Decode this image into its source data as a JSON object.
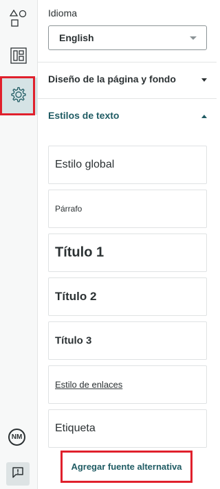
{
  "sidebar": {
    "items": [
      {
        "icon": "shapes-icon"
      },
      {
        "icon": "layout-icon"
      },
      {
        "icon": "gear-icon",
        "active": true
      }
    ],
    "avatar_initials": "NM",
    "feedback_icon": "feedback-icon"
  },
  "language": {
    "label": "Idioma",
    "value": "English"
  },
  "sections": {
    "background": {
      "title": "Diseño de la página y fondo"
    },
    "text_styles": {
      "title": "Estilos de texto"
    }
  },
  "text_styles": [
    {
      "label": "Estilo global"
    },
    {
      "label": "Párrafo"
    },
    {
      "label": "Título 1"
    },
    {
      "label": "Título 2"
    },
    {
      "label": "Título 3"
    },
    {
      "label": "Estilo de enlaces"
    },
    {
      "label": "Etiqueta"
    }
  ],
  "add_font_label": "Agregar fuente alternativa",
  "colors": {
    "accent": "#1f5b63",
    "highlight": "#e0202c",
    "active_bg": "#d5e3e5"
  }
}
